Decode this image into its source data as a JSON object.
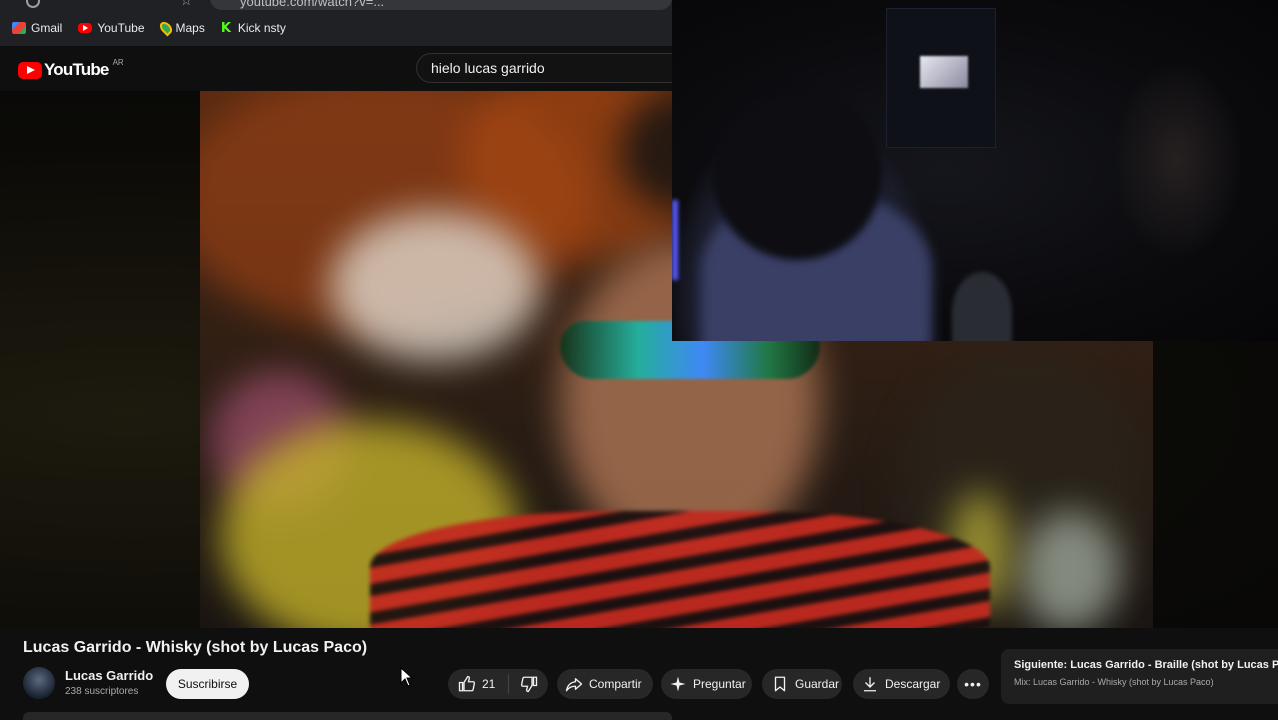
{
  "browser": {
    "url": "youtube.com/watch?v=...",
    "bookmarks": [
      {
        "label": "Gmail",
        "icon": "gmail-icon"
      },
      {
        "label": "YouTube",
        "icon": "youtube-icon"
      },
      {
        "label": "Maps",
        "icon": "maps-icon"
      },
      {
        "label": "Kick nsty",
        "icon": "kick-icon"
      }
    ]
  },
  "header": {
    "logo_text": "YouTube",
    "region": "AR",
    "search_value": "hielo lucas garrido"
  },
  "video": {
    "title": "Lucas Garrido - Whisky (shot by Lucas Paco)",
    "channel_name": "Lucas Garrido",
    "subscribers": "238 suscriptores",
    "subscribe_label": "Suscribirse",
    "like_count": "21",
    "share_label": "Compartir",
    "ask_label": "Preguntar",
    "save_label": "Guardar",
    "download_label": "Descargar",
    "more_label": "•••"
  },
  "next_up": {
    "title": "Siguiente: Lucas Garrido - Braille (shot by Lucas Pa...",
    "subtitle": "Mix: Lucas Garrido - Whisky (shot by Lucas Paco)"
  },
  "colors": {
    "background": "#0f0f0f",
    "accent": "#ff0000",
    "pill": "#272727",
    "subscribe_bg": "#f1f1f1"
  }
}
